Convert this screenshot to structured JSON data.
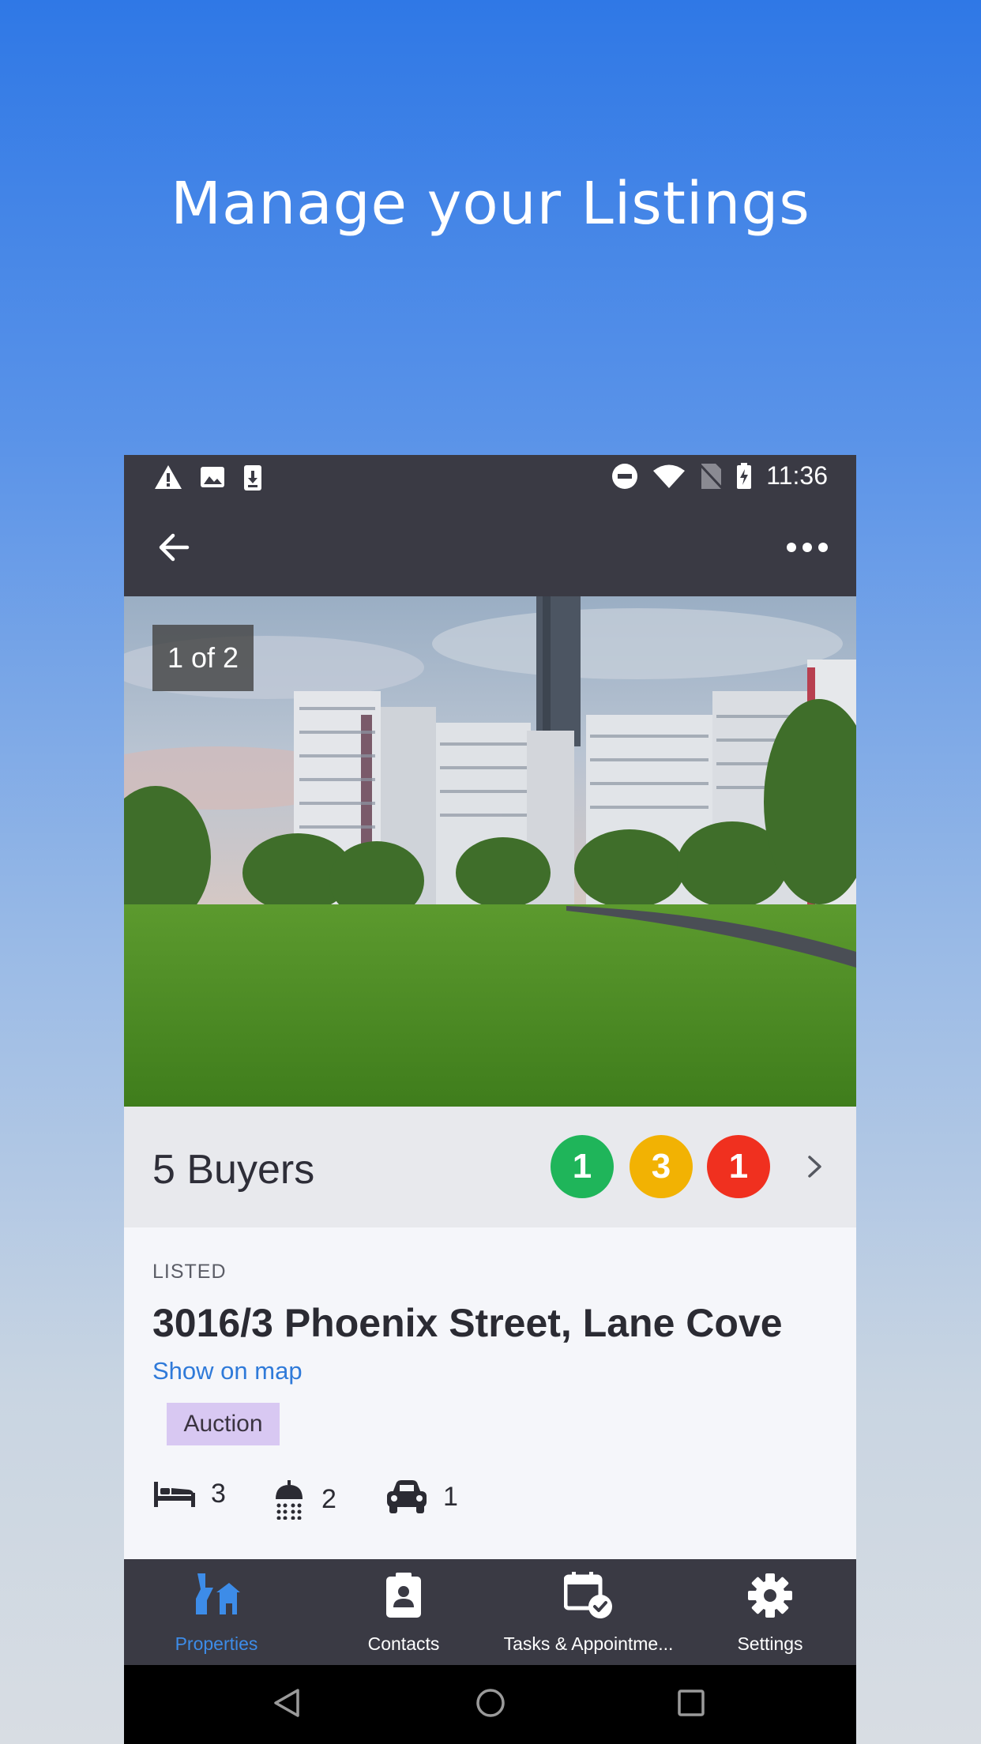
{
  "headline": "Manage your Listings",
  "status_bar": {
    "time": "11:36",
    "left_icons": [
      "warning-icon",
      "image-icon",
      "download-icon"
    ],
    "right_icons": [
      "do-not-disturb-icon",
      "wifi-icon",
      "no-sim-icon",
      "battery-charging-icon"
    ]
  },
  "toolbar": {
    "back_icon": "arrow-left-icon",
    "menu_icon": "more-horizontal-icon"
  },
  "photo": {
    "counter": "1 of 2"
  },
  "buyers": {
    "label": "5 Buyers",
    "counts": [
      {
        "value": "1",
        "color": "#1fb55a"
      },
      {
        "value": "3",
        "color": "#f2b203"
      },
      {
        "value": "1",
        "color": "#f0301f"
      }
    ]
  },
  "listing": {
    "status": "LISTED",
    "address": "3016/3 Phoenix Street, Lane Cove",
    "map_link": "Show on map",
    "sale_type": "Auction",
    "bedrooms": "3",
    "bathrooms": "2",
    "parking": "1"
  },
  "bottom_nav": {
    "items": [
      {
        "label": "Properties",
        "icon": "properties-icon",
        "active": true
      },
      {
        "label": "Contacts",
        "icon": "contact-card-icon",
        "active": false
      },
      {
        "label": "Tasks & Appointme...",
        "icon": "calendar-check-icon",
        "active": false
      },
      {
        "label": "Settings",
        "icon": "gear-icon",
        "active": false
      }
    ]
  },
  "colors": {
    "accent": "#3d8ce8",
    "bar_dark": "#3a3a44",
    "link": "#2f7ad9",
    "auction_badge": "#d8c8f2"
  }
}
